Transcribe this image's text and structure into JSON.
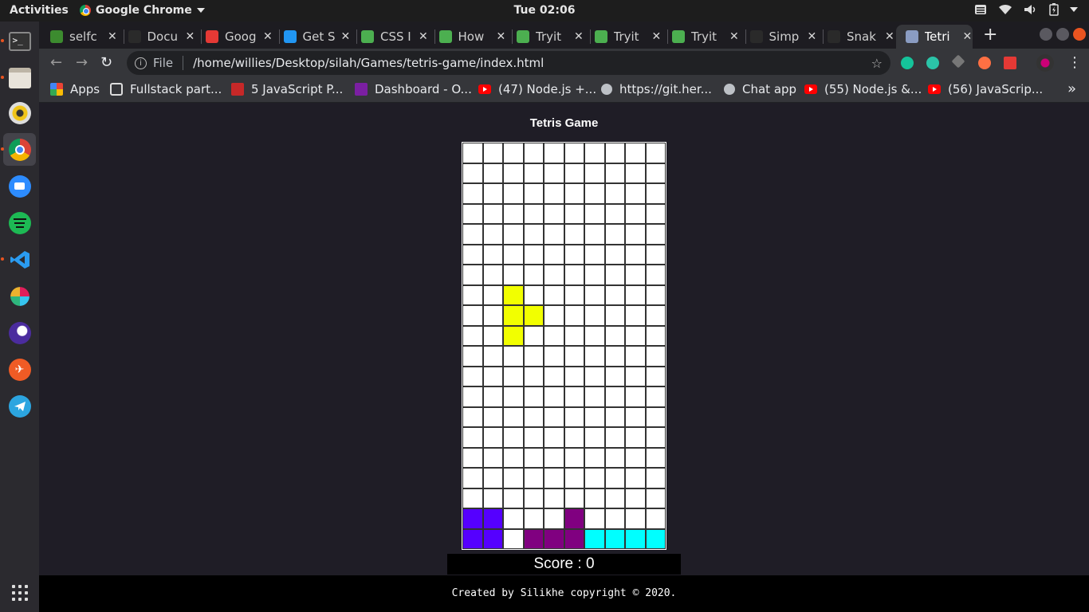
{
  "topbar": {
    "activities": "Activities",
    "app_name": "Google Chrome",
    "clock": "Tue 02:06"
  },
  "tabs": [
    {
      "title": "selfc",
      "fav_color": "#3c8b2f",
      "active": false
    },
    {
      "title": "Docu",
      "fav_color": "#2a2a2a",
      "active": false
    },
    {
      "title": "Goog",
      "fav_color": "#e53935",
      "active": false
    },
    {
      "title": "Get S",
      "fav_color": "#2196f3",
      "active": false
    },
    {
      "title": "CSS I",
      "fav_color": "#4caf50",
      "active": false
    },
    {
      "title": "How",
      "fav_color": "#4caf50",
      "active": false
    },
    {
      "title": "Tryit",
      "fav_color": "#4caf50",
      "active": false
    },
    {
      "title": "Tryit",
      "fav_color": "#4caf50",
      "active": false
    },
    {
      "title": "Tryit",
      "fav_color": "#4caf50",
      "active": false
    },
    {
      "title": "Simp",
      "fav_color": "#2a2a2a",
      "active": false
    },
    {
      "title": "Snak",
      "fav_color": "#2a2a2a",
      "active": false
    },
    {
      "title": "Tetri",
      "fav_color": "#8a9cc2",
      "active": true
    }
  ],
  "toolbar": {
    "file_label": "File",
    "url": "/home/willies/Desktop/silah/Games/tetris-game/index.html"
  },
  "bookmarks": [
    {
      "label": "Apps",
      "icon": "apps-grid-icon"
    },
    {
      "label": "Fullstack part...",
      "icon": "page-icon"
    },
    {
      "label": "5 JavaScript P...",
      "icon": "code-icon"
    },
    {
      "label": "Dashboard - O...",
      "icon": "dashboard-icon"
    },
    {
      "label": "(47) Node.js +...",
      "icon": "youtube-icon"
    },
    {
      "label": "https://git.her...",
      "icon": "globe-icon"
    },
    {
      "label": "Chat app",
      "icon": "globe-icon"
    },
    {
      "label": "(55) Node.js &...",
      "icon": "youtube-icon"
    },
    {
      "label": "(56) JavaScrip...",
      "icon": "youtube-icon"
    }
  ],
  "game": {
    "title": "Tetris Game",
    "score_text": "Score : 0",
    "columns": 10,
    "rows": 20,
    "filled_cells": [
      {
        "row": 7,
        "col": 2,
        "color": "#f2ff00"
      },
      {
        "row": 8,
        "col": 2,
        "color": "#f2ff00"
      },
      {
        "row": 8,
        "col": 3,
        "color": "#f2ff00"
      },
      {
        "row": 9,
        "col": 2,
        "color": "#f2ff00"
      },
      {
        "row": 18,
        "col": 0,
        "color": "#5500ff"
      },
      {
        "row": 18,
        "col": 1,
        "color": "#5500ff"
      },
      {
        "row": 19,
        "col": 0,
        "color": "#5500ff"
      },
      {
        "row": 19,
        "col": 1,
        "color": "#5500ff"
      },
      {
        "row": 18,
        "col": 5,
        "color": "#800080"
      },
      {
        "row": 19,
        "col": 3,
        "color": "#800080"
      },
      {
        "row": 19,
        "col": 4,
        "color": "#800080"
      },
      {
        "row": 19,
        "col": 5,
        "color": "#800080"
      },
      {
        "row": 19,
        "col": 6,
        "color": "#00ffff"
      },
      {
        "row": 19,
        "col": 7,
        "color": "#00ffff"
      },
      {
        "row": 19,
        "col": 8,
        "color": "#00ffff"
      },
      {
        "row": 19,
        "col": 9,
        "color": "#00ffff"
      }
    ]
  },
  "footer": {
    "text": "Created by Silikhe copyright © 2020."
  }
}
